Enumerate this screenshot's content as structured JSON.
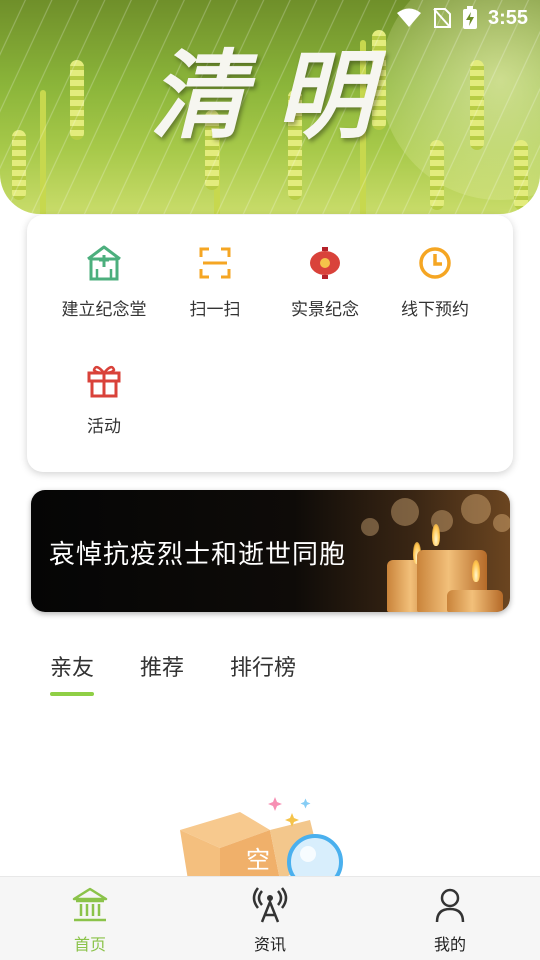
{
  "status_bar": {
    "time": "3:55"
  },
  "hero": {
    "title": "清明"
  },
  "quick_actions": [
    {
      "label": "建立纪念堂",
      "icon": "memorial-hall-icon"
    },
    {
      "label": "扫一扫",
      "icon": "scan-icon"
    },
    {
      "label": "实景纪念",
      "icon": "lantern-icon"
    },
    {
      "label": "线下预约",
      "icon": "clock-icon"
    },
    {
      "label": "活动",
      "icon": "gift-icon"
    }
  ],
  "banner": {
    "text": "哀悼抗疫烈士和逝世同胞"
  },
  "tabs": [
    {
      "label": "亲友",
      "active": true
    },
    {
      "label": "推荐",
      "active": false
    },
    {
      "label": "排行榜",
      "active": false
    }
  ],
  "empty_state": {
    "label": "空"
  },
  "bottom_nav": [
    {
      "label": "首页",
      "icon": "home-icon",
      "active": true
    },
    {
      "label": "资讯",
      "icon": "broadcast-tower-icon",
      "active": false
    },
    {
      "label": "我的",
      "icon": "person-icon",
      "active": false
    }
  ],
  "colors": {
    "accent": "#8bc34a",
    "icon_green": "#4caf7d",
    "icon_orange": "#f5a623",
    "icon_red": "#d9423a"
  }
}
